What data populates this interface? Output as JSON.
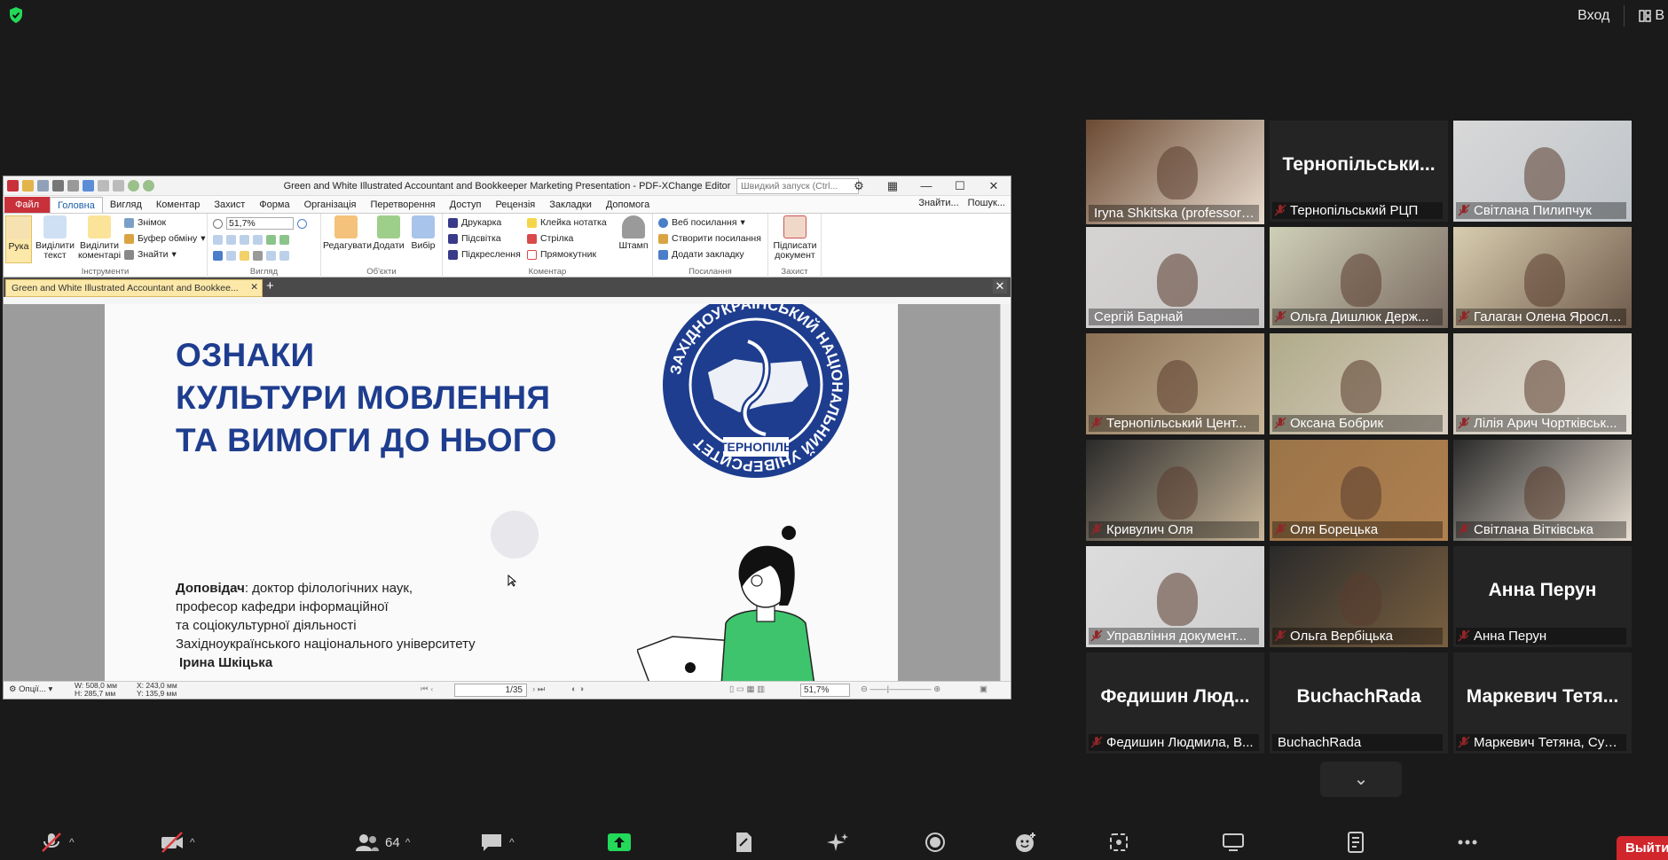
{
  "top_bar": {
    "enter_label": "Вход",
    "view_label": "В"
  },
  "editor": {
    "window_title": "Green and White Illustrated Accountant and Bookkeeper Marketing Presentation - PDF-XChange Editor",
    "quick_launch_placeholder": "Швидкий запуск (Ctrl...",
    "menu": [
      "Файл",
      "Головна",
      "Вигляд",
      "Коментар",
      "Захист",
      "Форма",
      "Організація",
      "Перетворення",
      "Доступ",
      "Рецензія",
      "Закладки",
      "Допомога"
    ],
    "menu_right": [
      "Знайти...",
      "Пошук..."
    ],
    "ribbon": {
      "hand": "Рука",
      "select_text": "Виділити текст",
      "select_comments": "Виділити коментарі",
      "snapshot": "Знімок",
      "clipboard": "Буфер обміну",
      "find": "Знайти",
      "group_tools": "Інструменти",
      "zoom_value": "51,7%",
      "group_view": "Вигляд",
      "edit": "Редагувати",
      "add": "Додати",
      "select": "Вибір",
      "group_objects": "Об'єкти",
      "typewriter": "Друкарка",
      "highlight": "Підсвітка",
      "underline": "Підкреслення",
      "sticky_note": "Клейка нотатка",
      "arrow": "Стрілка",
      "rectangle": "Прямокутник",
      "stamp": "Штамп",
      "group_comment": "Коментар",
      "web_links": "Веб посилання",
      "create_link": "Створити посилання",
      "add_bookmark": "Додати закладку",
      "group_links": "Посилання",
      "sign_doc": "Підписати документ",
      "group_protect": "Захист"
    },
    "doc_tab": "Green and White Illustrated Accountant and Bookkee...",
    "slide": {
      "title_lines": [
        "ОЗНАКИ",
        "КУЛЬТУРИ МОВЛЕННЯ",
        "ТА ВИМОГИ ДО НЬОГО"
      ],
      "speaker_label": "Доповідач",
      "speaker_rest": ": доктор філологічних наук,",
      "speaker_lines": [
        "професор кафедри інформаційної",
        "та соціокультурної діяльності",
        "Західноукраїнського національного університету"
      ],
      "speaker_name": "Ірина Шкіцька",
      "logo_ring_text": "ЗАХІДНОУКРАЇНСЬКИЙ НАЦІОНАЛЬНИЙ УНІВЕРСИТЕТ",
      "logo_city": "ТЕРНОПІЛЬ"
    },
    "status": {
      "options": "Опції...",
      "size_w": "W: 508,0 мм",
      "size_h": "H: 285,7 мм",
      "pos_x": "X: 243,0 мм",
      "pos_y": "Y: 135,9 мм",
      "page": "1/35",
      "zoom": "51,7%"
    }
  },
  "participants": [
    {
      "name": "Iryna Shkitska (professor ...",
      "muted": false,
      "video": true,
      "active": true
    },
    {
      "name": "Тернопільський РЦП",
      "big": "Тернопільськи...",
      "muted": true,
      "video": false
    },
    {
      "name": "Світлана Пилипчук",
      "muted": true,
      "video": true
    },
    {
      "name": "Сергій Барнай",
      "muted": false,
      "video": true
    },
    {
      "name": "Ольга Дишлюк Держ...",
      "muted": true,
      "video": true
    },
    {
      "name": "Галаган Олена Яросла...",
      "muted": true,
      "video": true
    },
    {
      "name": "Тернопільський Цент...",
      "muted": true,
      "video": true
    },
    {
      "name": "Оксана Бобрик",
      "muted": true,
      "video": true
    },
    {
      "name": "Лілія Арич Чортківськ...",
      "muted": true,
      "video": true
    },
    {
      "name": "Кривулич Оля",
      "muted": true,
      "video": true
    },
    {
      "name": "Оля Борецька",
      "muted": true,
      "video": true
    },
    {
      "name": "Світлана Вітківська",
      "muted": true,
      "video": true
    },
    {
      "name": "Управління документ...",
      "muted": true,
      "video": true
    },
    {
      "name": "Ольга Вербіцька",
      "muted": true,
      "video": true
    },
    {
      "name": "Анна Перун",
      "big": "Анна Перун",
      "muted": true,
      "video": false
    },
    {
      "name": "Федишин Людмила, В...",
      "big": "Федишин Люд...",
      "muted": true,
      "video": false
    },
    {
      "name": "BuchachRada",
      "big": "BuchachRada",
      "muted": false,
      "video": false
    },
    {
      "name": "Маркевич Тетяна, Сул...",
      "big": "Маркевич Тетя...",
      "muted": true,
      "video": false
    }
  ],
  "toolbar": {
    "participants_count": "64",
    "leave_label": "Выйти"
  },
  "colors": {
    "accent_active": "#cfe07a",
    "leave": "#d0262c",
    "share": "#23d959",
    "slide_title": "#1e3d8f"
  }
}
